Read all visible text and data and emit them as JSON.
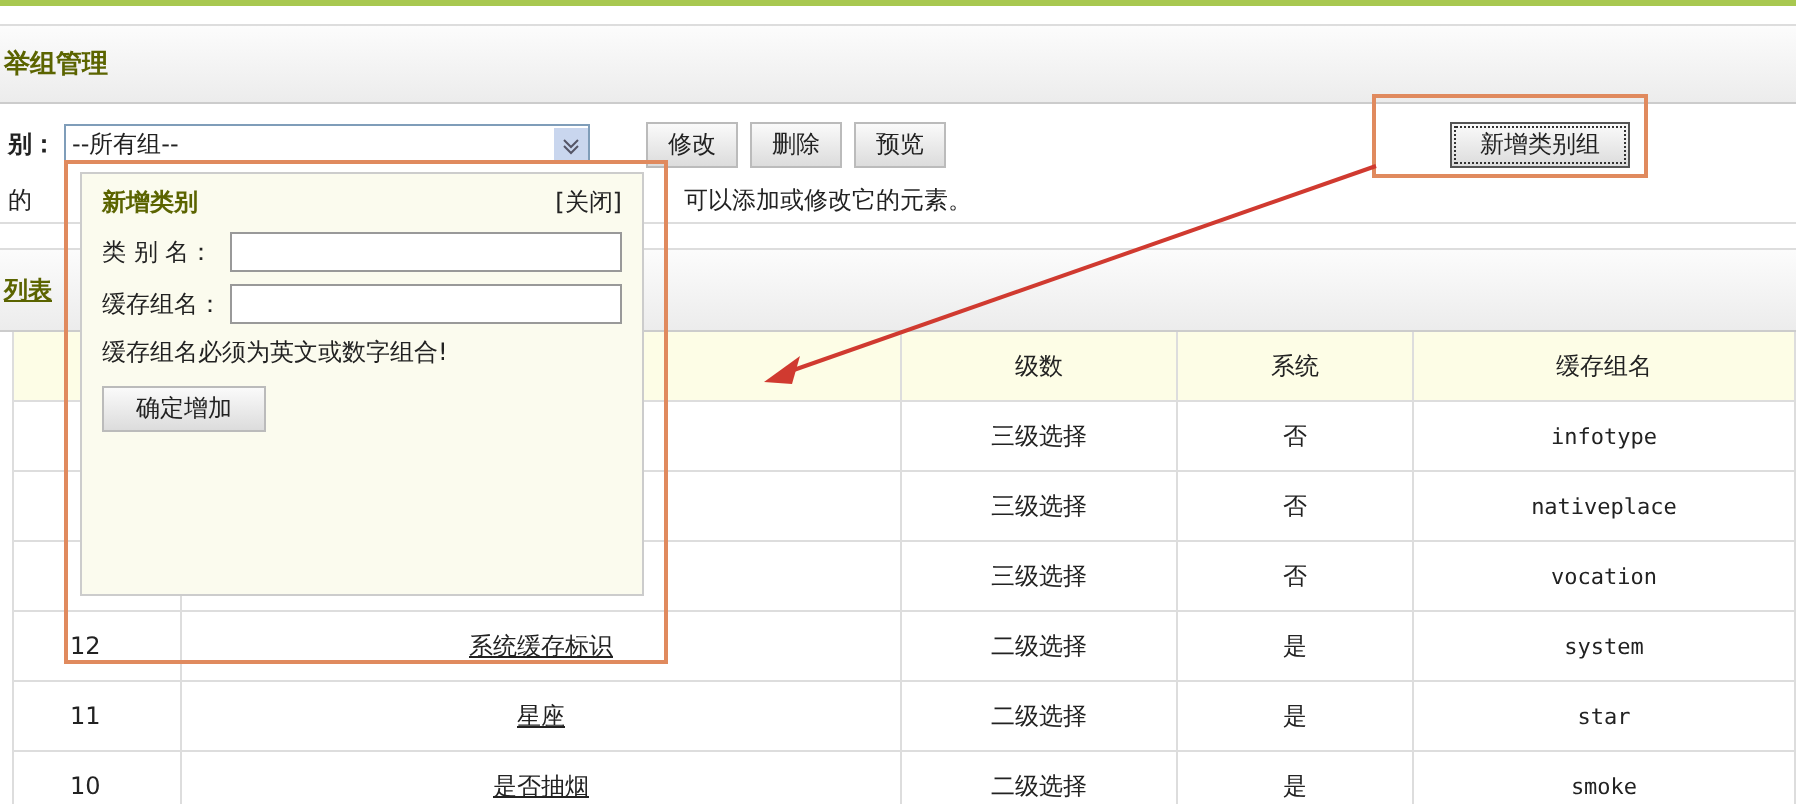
{
  "page_title": "举组管理",
  "filter": {
    "label": "别：",
    "value": "--所有组--"
  },
  "buttons": [
    "修改",
    "删除",
    "预览"
  ],
  "add_group_button": "新增类别组",
  "description": {
    "before": "的",
    "after": "可以添加或修改它的元素。"
  },
  "list_link": "列表",
  "table": {
    "columns": [
      "级数",
      "系统",
      "缓存组名"
    ],
    "rows": [
      {
        "level": "三级选择",
        "system": "否",
        "cache_name": "infotype"
      },
      {
        "level": "三级选择",
        "system": "否",
        "cache_name": "nativeplace"
      },
      {
        "level": "三级选择",
        "system": "否",
        "cache_name": "vocation"
      },
      {
        "id": "12",
        "name": "系统缓存标识",
        "level": "二级选择",
        "system": "是",
        "cache_name": "system"
      },
      {
        "id": "11",
        "name": "星座",
        "level": "二级选择",
        "system": "是",
        "cache_name": "star"
      },
      {
        "id": "10",
        "name": "是否抽烟",
        "level": "二级选择",
        "system": "是",
        "cache_name": "smoke"
      }
    ]
  },
  "popup": {
    "title": "新增类别",
    "close": "[关闭]",
    "fields": [
      {
        "label": "类 别 名："
      },
      {
        "label": "缓存组名："
      }
    ],
    "hint": "缓存组名必须为英文或数字组合!",
    "submit": "确定增加"
  }
}
